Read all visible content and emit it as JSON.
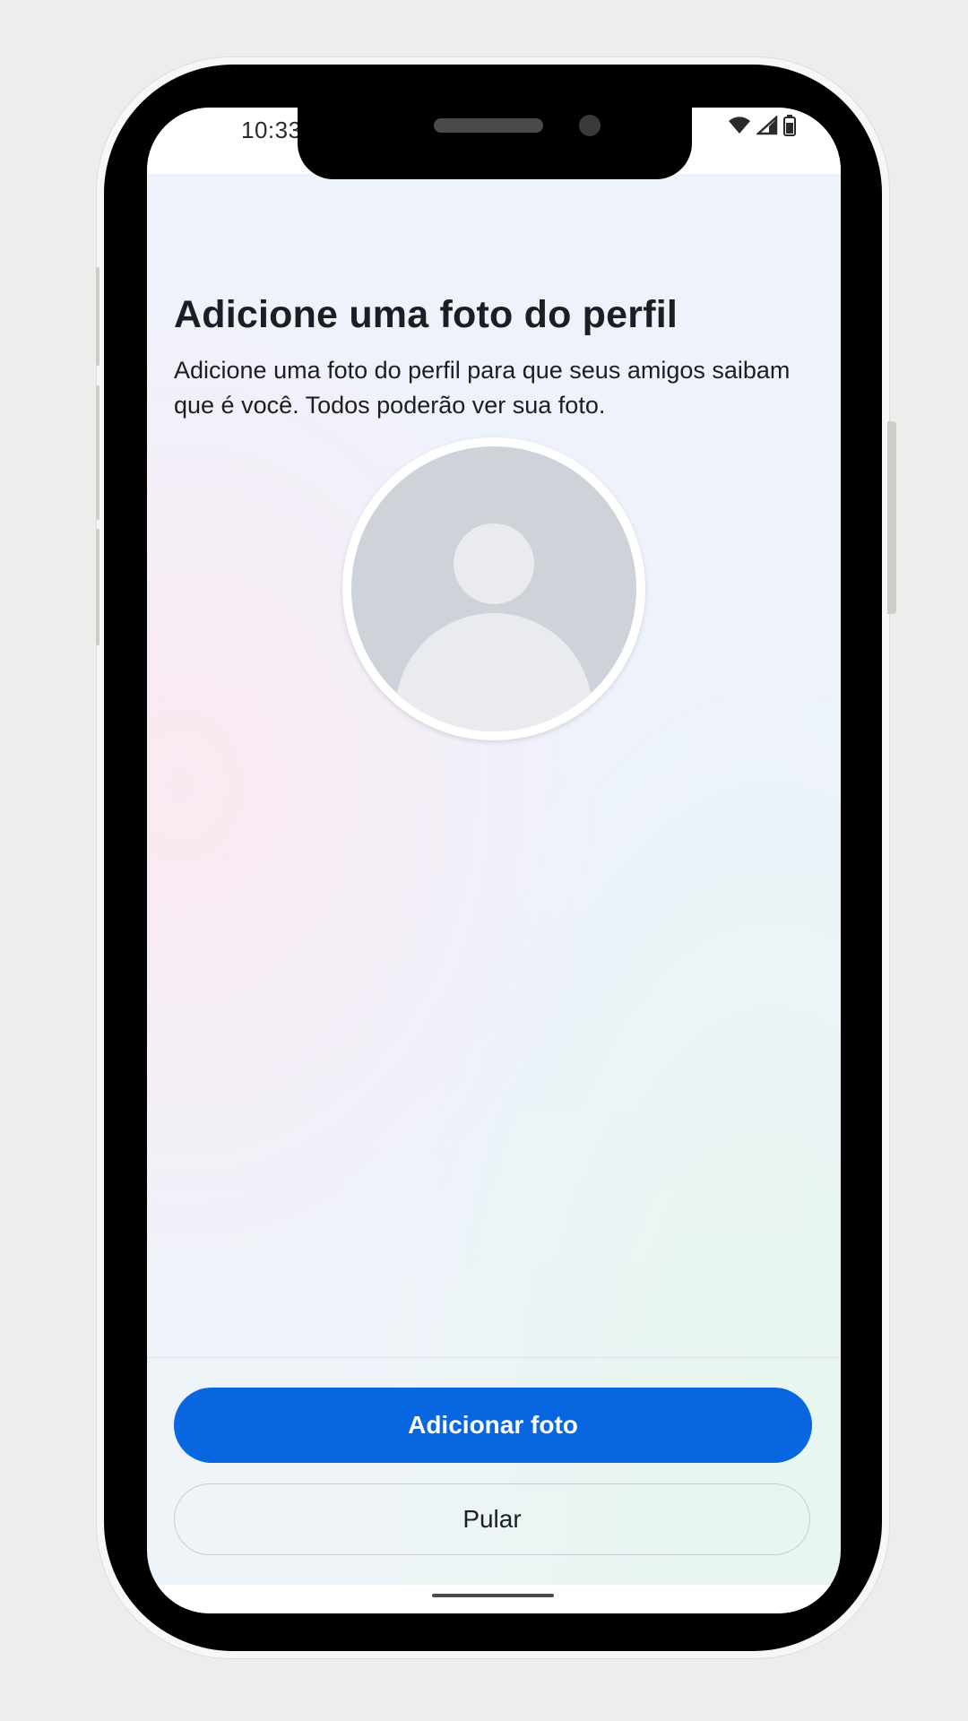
{
  "status_bar": {
    "time": "10:33",
    "icons": [
      "wifi-icon",
      "cell-signal-icon",
      "battery-icon"
    ]
  },
  "page": {
    "title": "Adicione uma foto do perfil",
    "subtitle": "Adicione uma foto do perfil para que seus amigos saibam que é você. Todos poderão ver sua foto.",
    "avatar_icon": "default-profile-avatar-icon"
  },
  "actions": {
    "primary_label": "Adicionar foto",
    "secondary_label": "Pular"
  },
  "colors": {
    "primary": "#0866e0",
    "text": "#1c1e21",
    "avatar_bg": "#ced3da",
    "avatar_fg": "#e9ebee"
  }
}
